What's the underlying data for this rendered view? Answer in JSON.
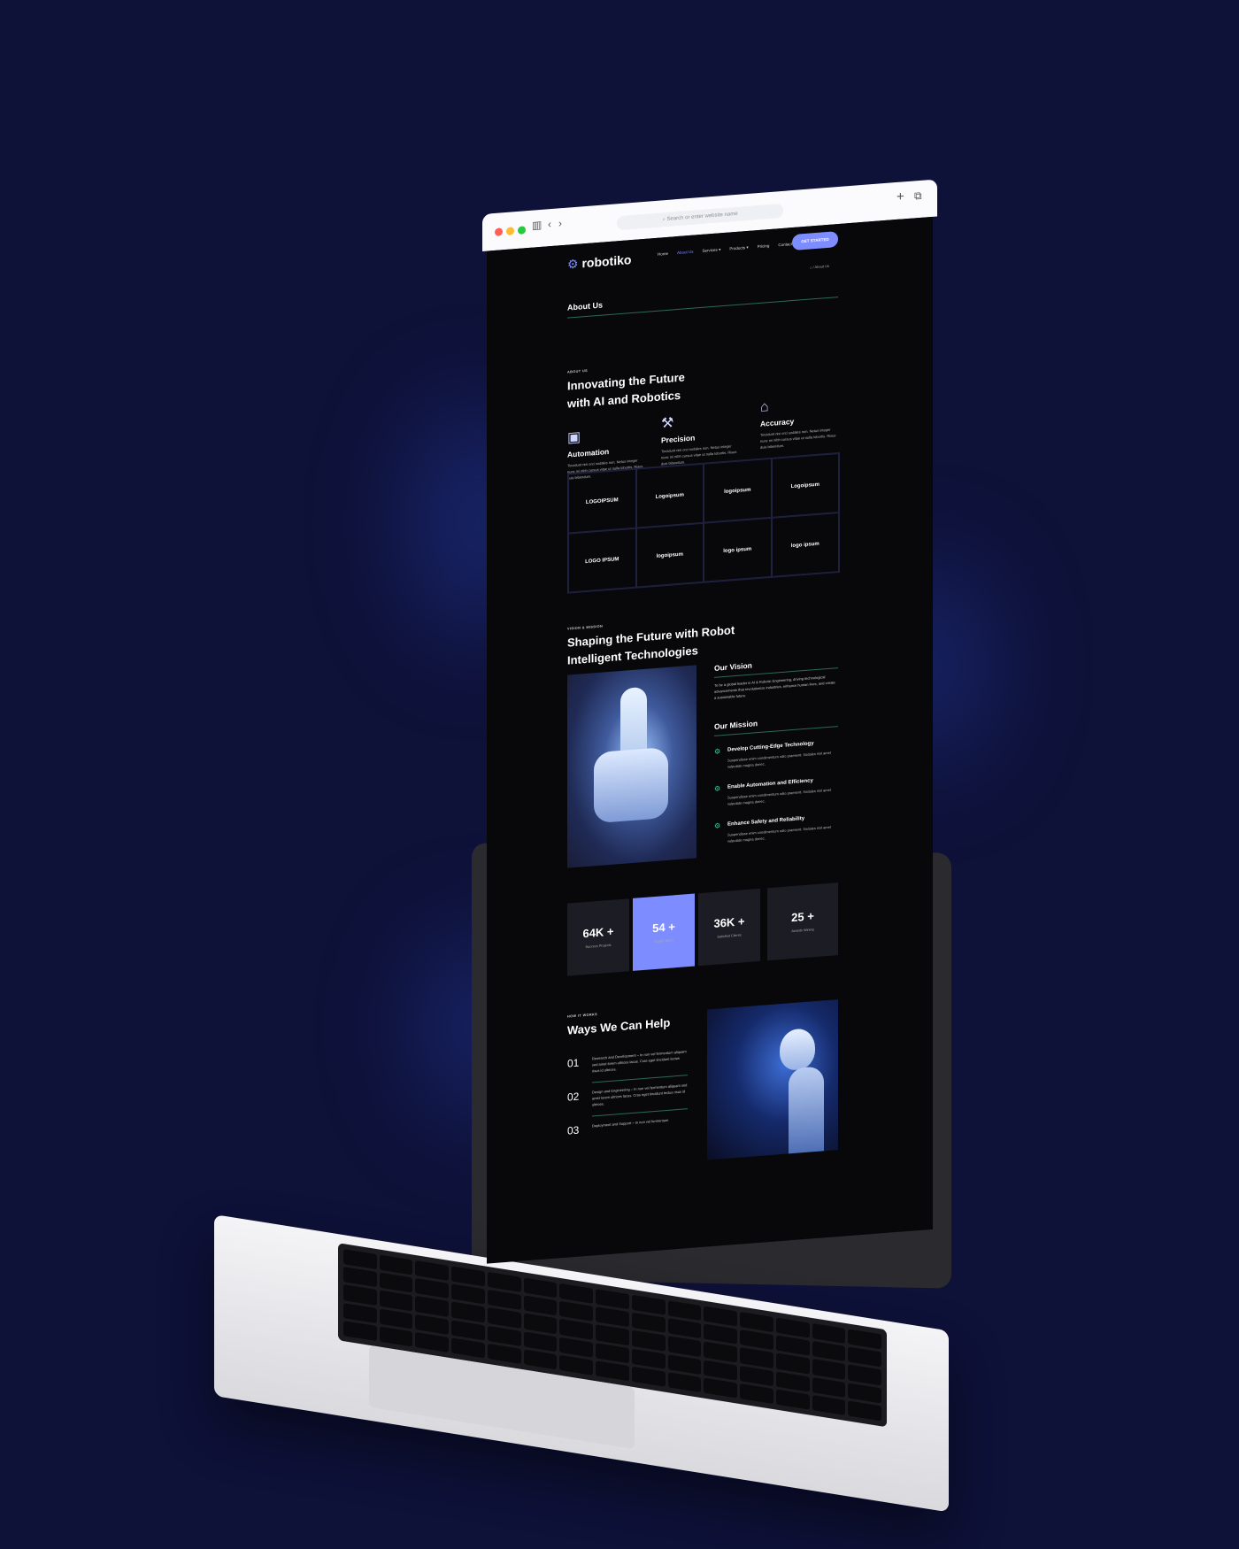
{
  "browser": {
    "url_placeholder": "Search or enter website name",
    "plus_icon": "plus-icon",
    "tabs_icon": "tabs-icon"
  },
  "nav": {
    "logo_text": "robotiko",
    "items": [
      "Home",
      "About Us",
      "Services",
      "Products",
      "Pricing",
      "Contact Us"
    ],
    "active": "About Us",
    "cta": "GET STARTED"
  },
  "breadcrumb": {
    "current": "About Us"
  },
  "page_title": "About Us",
  "about": {
    "eyebrow": "ABOUT US",
    "title_line1": "Innovating the Future",
    "title_line2": "with AI and Robotics",
    "features": [
      {
        "icon": "monitor-icon",
        "title": "Automation",
        "desc": "Tincidunt nisi orci sodales non. Netus integer nunc mi nibh cursus vitae ut nulla lobortis. Risus duis bibendum."
      },
      {
        "icon": "robot-arm-icon",
        "title": "Precision",
        "desc": "Tincidunt nisi orci sodales non. Netus integer nunc mi nibh cursus vitae ut nulla lobortis. Risus duis bibendum."
      },
      {
        "icon": "factory-icon",
        "title": "Accuracy",
        "desc": "Tincidunt nisi orci sodales non. Netus integer nunc mi nibh cursus vitae ut nulla lobortis. Risus duis bibendum."
      }
    ]
  },
  "logos": [
    "LOGOIPSUM",
    "Logoipsum",
    "logoipsum",
    "Logoipsum",
    "LOGO IPSUM",
    "logoipsum",
    "logo ipsum",
    "logo ipsum"
  ],
  "vision": {
    "eyebrow": "VISION & MISSION",
    "title_line1": "Shaping the Future with Robot",
    "title_line2": "Intelligent Technologies",
    "vision_title": "Our Vision",
    "vision_text": "To be a global leader in AI & Robotic Engineering, driving technological advancements that revolutionize industries, enhance human lives, and create a sustainable future.",
    "mission_title": "Our Mission",
    "missions": [
      {
        "title": "Develop Cutting-Edge Technology",
        "desc": "Suspendisse enim condimentum odio praesent. Sodales nisl amet vulputate magna donec."
      },
      {
        "title": "Enable Automation and Efficiency",
        "desc": "Suspendisse enim condimentum odio praesent. Sodales nisl amet vulputate magna donec."
      },
      {
        "title": "Enhance Safety and Reliability",
        "desc": "Suspendisse enim condimentum odio praesent. Sodales nisl amet vulputate magna donec."
      }
    ]
  },
  "stats": [
    {
      "value": "64K +",
      "label": "Success Projects"
    },
    {
      "value": "54 +",
      "label": "Expert Team"
    },
    {
      "value": "36K +",
      "label": "Satisfied Clients"
    },
    {
      "value": "25 +",
      "label": "Awards Wining"
    }
  ],
  "how": {
    "eyebrow": "HOW IT WORKS",
    "title": "Ways We Can Help",
    "steps": [
      {
        "num": "01",
        "desc": "Research and Development – In non vel fermentum aliquam sed amet lorem ultrices lacus. Cras eget tincidunt lectus risus id ultrices."
      },
      {
        "num": "02",
        "desc": "Design and Engineering – In non vel fermentum aliquam sed amet lorem ultrices lacus. Cras eget tincidunt lectus risus id ultrices."
      },
      {
        "num": "03",
        "desc": "Deployment and Support – In non vel fermentum"
      }
    ]
  },
  "colors": {
    "accent": "#7d8cff",
    "background": "#0e1138",
    "page": "#08080a",
    "rule": "#2b6a55"
  }
}
